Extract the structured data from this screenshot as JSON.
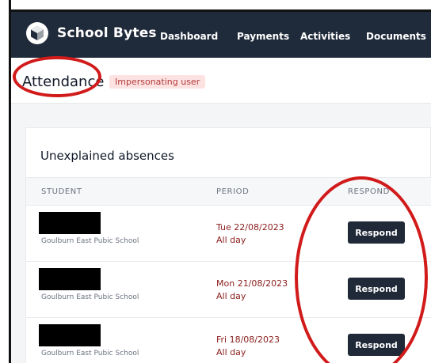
{
  "app": {
    "brand": "School Bytes",
    "nav": [
      "Dashboard",
      "Payments",
      "Activities",
      "Documents"
    ]
  },
  "page": {
    "title": "Attendance",
    "badge": "Impersonating user"
  },
  "card": {
    "title": "Unexplained absences",
    "columns": [
      "STUDENT",
      "PERIOD",
      "RESPOND"
    ],
    "rows": [
      {
        "school": "Goulburn East Pubic School",
        "date": "Tue 22/08/2023",
        "time": "All day",
        "action": "Respond"
      },
      {
        "school": "Goulburn East Pubic School",
        "date": "Mon 21/08/2023",
        "time": "All day",
        "action": "Respond"
      },
      {
        "school": "Goulburn East Pubic School",
        "date": "Fri 18/08/2023",
        "time": "All day",
        "action": "Respond"
      }
    ]
  },
  "colors": {
    "topbar": "#1f2a3a",
    "annotation": "#d11a1a",
    "button": "#1f2937",
    "date_text": "#8a1c1c"
  }
}
